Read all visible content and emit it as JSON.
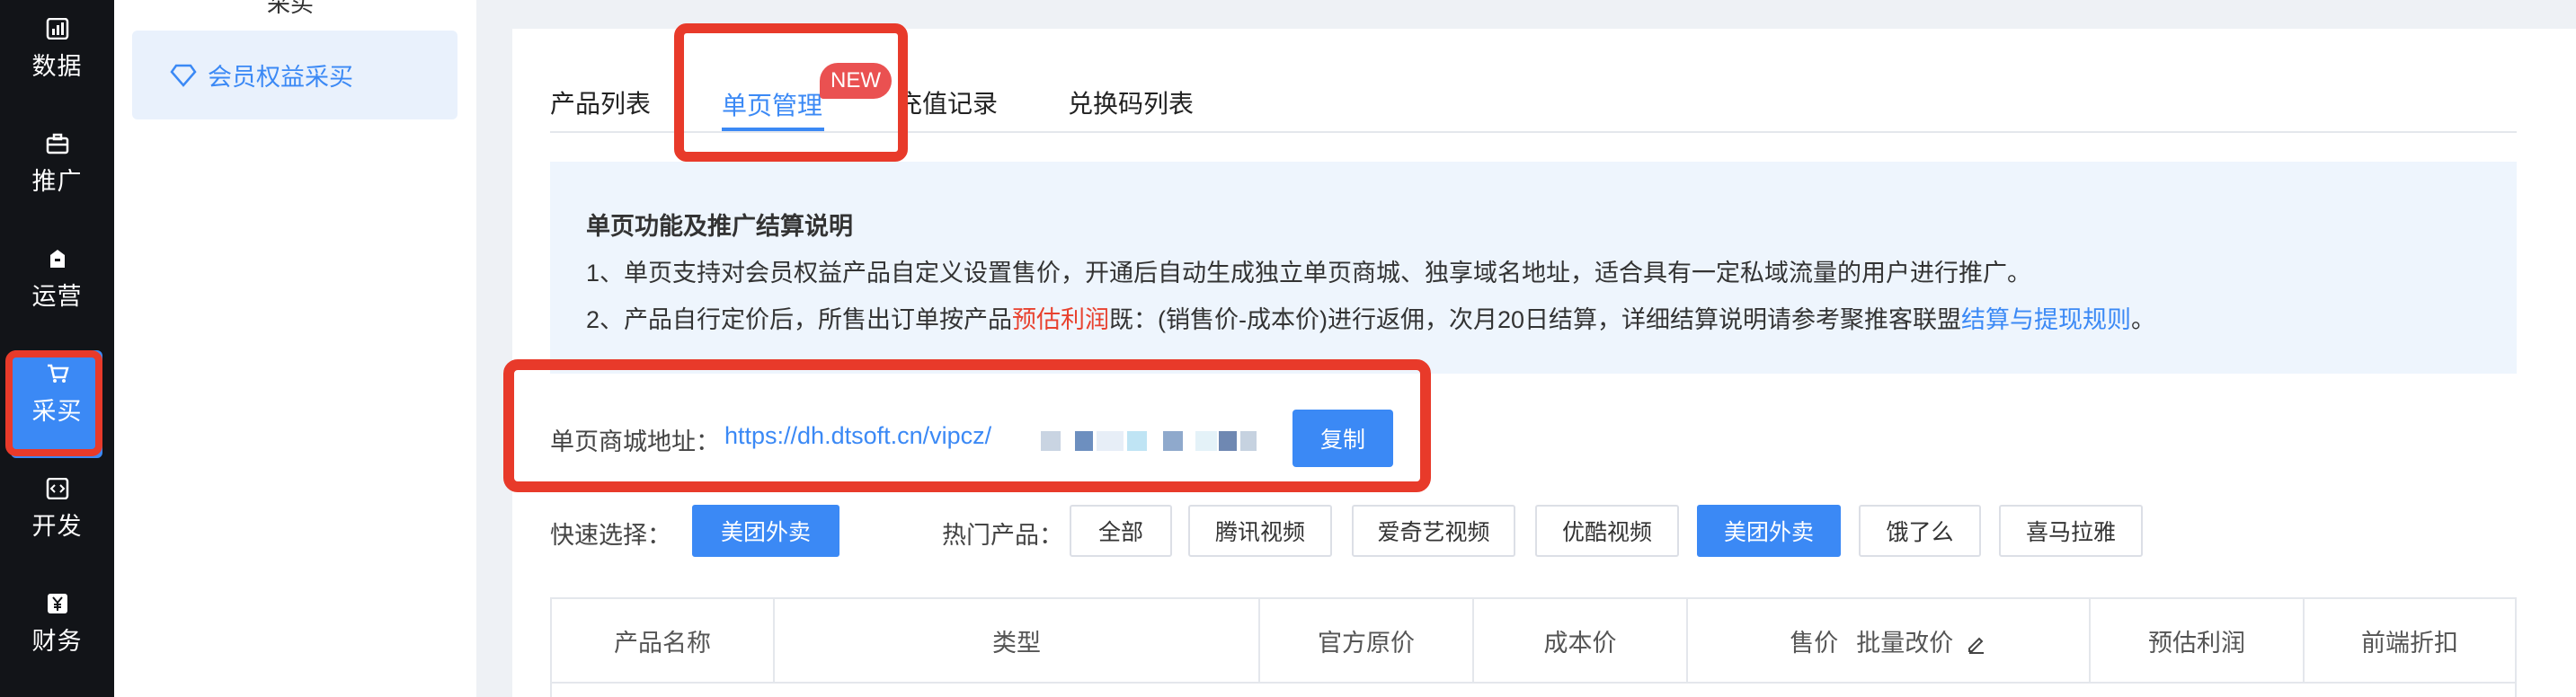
{
  "rail": {
    "items": [
      {
        "label": "数据",
        "icon": "chart-icon"
      },
      {
        "label": "推广",
        "icon": "briefcase-icon"
      },
      {
        "label": "运营",
        "icon": "shop-icon"
      },
      {
        "label": "采买",
        "icon": "cart-icon"
      },
      {
        "label": "开发",
        "icon": "code-icon"
      },
      {
        "label": "财务",
        "icon": "yen-icon"
      }
    ],
    "active_color": "#3b89f5"
  },
  "submenu": {
    "section_title": "采买",
    "item_label": "会员权益采买",
    "item_icon": "diamond-icon"
  },
  "tabs": [
    {
      "label": "产品列表"
    },
    {
      "label": "单页管理",
      "badge": "NEW",
      "active": true
    },
    {
      "label": "充值记录"
    },
    {
      "label": "兑换码列表"
    }
  ],
  "info": {
    "title": "单页功能及推广结算说明",
    "line1": "1、单页支持对会员权益产品自定义设置售价，开通后自动生成独立单页商城、独享域名地址，适合具有一定私域流量的用户进行推广。",
    "line2_pre": "2、产品自行定价后，所售出订单按产品",
    "line2_highlight": "预估利润",
    "line2_mid": "既：(销售价-成本价)进行返佣，次月20日结算，详细结算说明请参考聚推客联盟",
    "line2_link": "结算与提现规则",
    "line2_end": "。"
  },
  "shop_url": {
    "label": "单页商城地址：",
    "value": "https://dh.dtsoft.cn/vipcz/",
    "copy_label": "复制"
  },
  "quick_select": {
    "label": "快速选择：",
    "selected": "美团外卖"
  },
  "hot_products": {
    "label": "热门产品：",
    "options": [
      "全部",
      "腾讯视频",
      "爱奇艺视频",
      "优酷视频",
      "美团外卖",
      "饿了么",
      "喜马拉雅"
    ],
    "selected": "美团外卖"
  },
  "table": {
    "headers": [
      "产品名称",
      "类型",
      "官方原价",
      "成本价",
      "售价",
      "预估利润",
      "前端折扣"
    ],
    "bulk_edit_label": "批量改价"
  },
  "colors": {
    "primary": "#3b89f5",
    "highlight_red": "#e8422f",
    "callout": "#e83a2a"
  }
}
